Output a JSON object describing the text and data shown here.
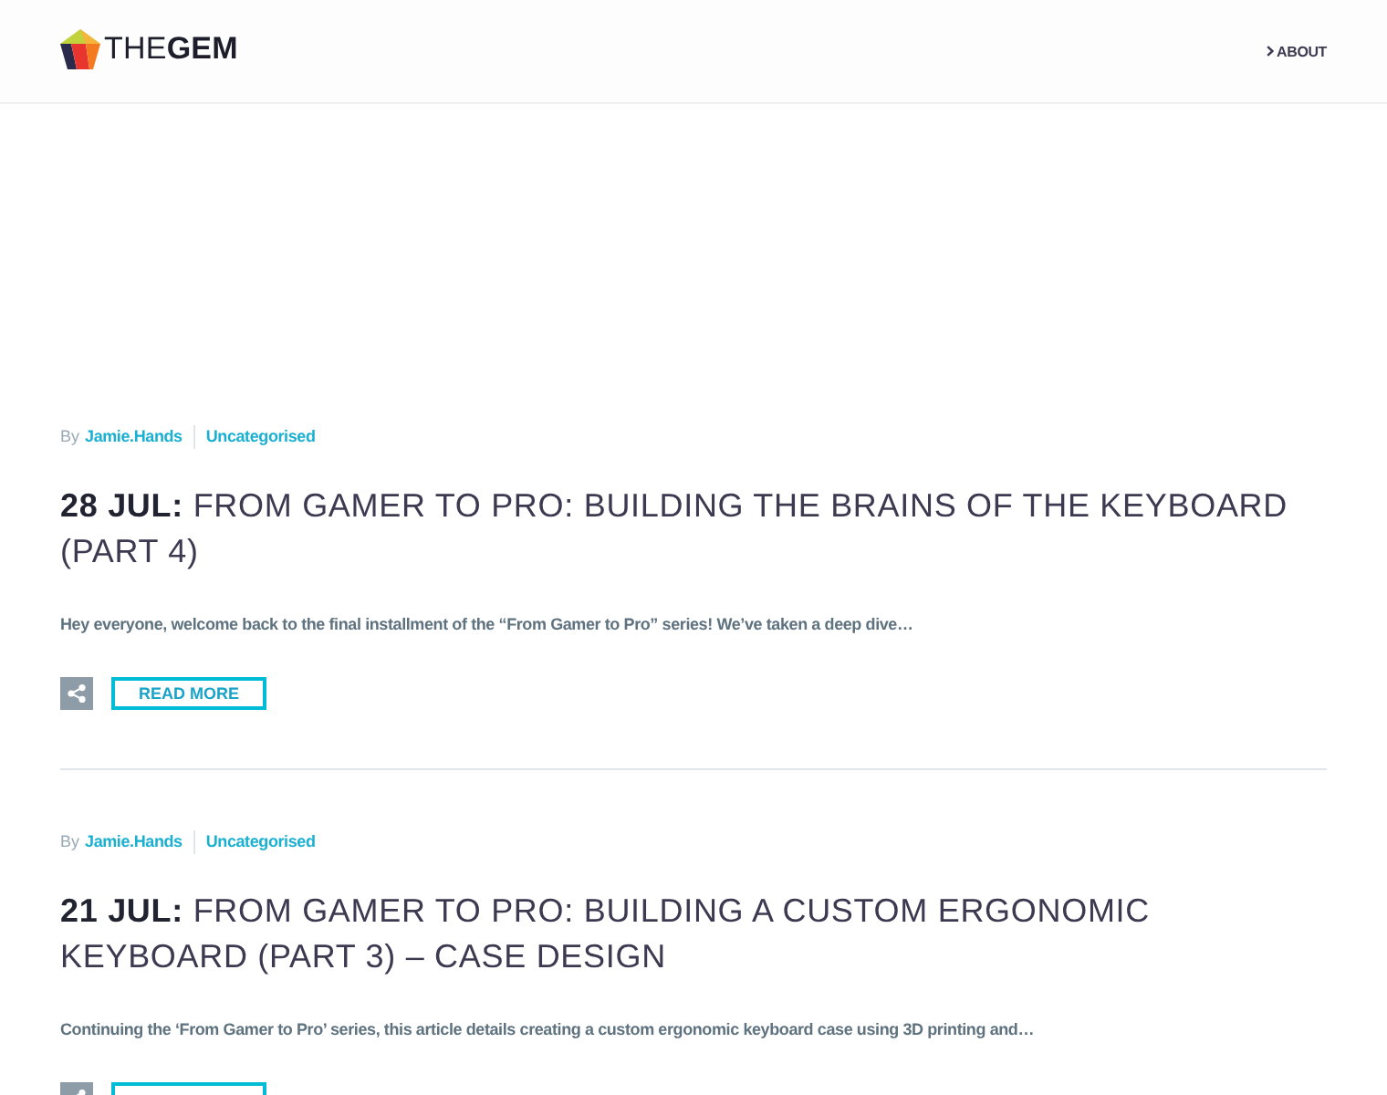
{
  "header": {
    "logo": {
      "text": "THE**GEM**"
    },
    "nav": [
      {
        "label": "ABOUT"
      }
    ]
  },
  "posts": [
    {
      "author_prefix": "By",
      "author": "Jamie.Hands",
      "category": "Uncategorised",
      "title": "**28 JUL:** FROM GAMER TO PRO: BUILDING THE BRAINS OF THE KEYBOARD (PART 4)",
      "excerpt": "Hey everyone, welcome back to the final installment of the “From Gamer to Pro” series! We’ve taken a deep dive…",
      "buttons": [
        {
          "kind": "share"
        },
        {
          "kind": "read_more",
          "label": "READ MORE"
        }
      ]
    },
    {
      "author_prefix": "By",
      "author": "Jamie.Hands",
      "category": "Uncategorised",
      "title": "**21 JUL:** FROM GAMER TO PRO: BUILDING A CUSTOM ERGONOMIC KEYBOARD (PART 3) – CASE DESIGN",
      "excerpt": "Continuing the ‘From Gamer to Pro’ series, this article details creating a custom ergonomic keyboard case using 3D printing and…",
      "buttons": [
        {
          "kind": "share"
        },
        {
          "kind": "read_more"
        }
      ]
    }
  ]
}
